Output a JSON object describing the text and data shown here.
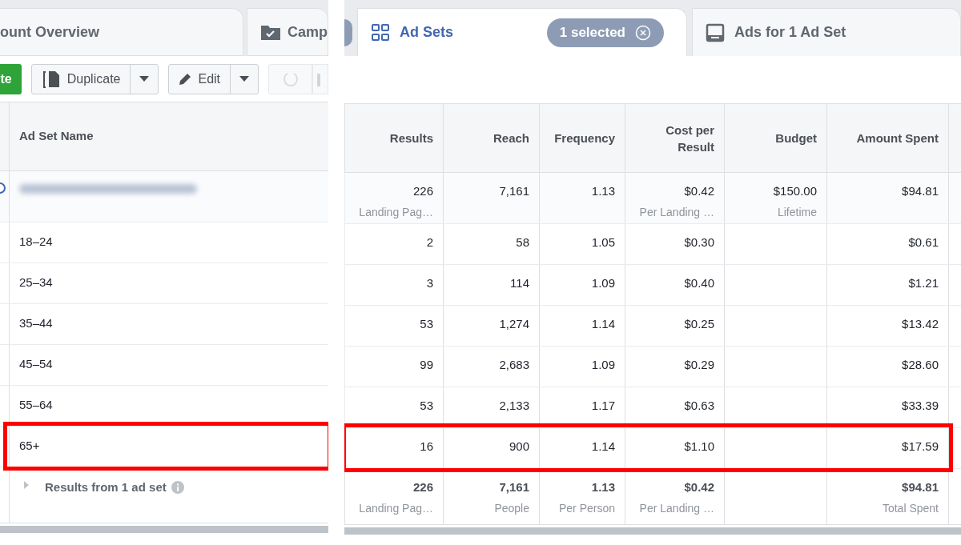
{
  "left_tabs": [
    {
      "label": "ount Overview",
      "selected": false
    },
    {
      "label": "Camp",
      "selected": false
    }
  ],
  "toolbar": [
    {
      "kind": "primary",
      "label": "te"
    },
    {
      "kind": "split",
      "label": "Duplicate"
    },
    {
      "kind": "split",
      "label": "Edit"
    },
    {
      "kind": "icon",
      "disabled": true
    },
    {
      "kind": "icon",
      "disabled": true
    }
  ],
  "right_tabs": [
    {
      "label": "Ad Sets",
      "selected": true,
      "badge": "1 selected"
    },
    {
      "label": "Ads for 1 Ad Set",
      "selected": false
    }
  ],
  "name_column": "Ad Set Name",
  "columns": [
    "Results",
    "Reach",
    "Frequency",
    "Cost per Result",
    "Budget",
    "Amount Spent"
  ],
  "rows": [
    {
      "kind": "ad_set",
      "radio_checked": true,
      "results": "226",
      "results_sub": "Landing Pag…",
      "reach": "7,161",
      "frequency": "1.13",
      "cost": "$0.42",
      "cost_sub": "Per Landing …",
      "budget": "$150.00",
      "budget_sub": "Lifetime",
      "spent": "$94.81",
      "highlighted": false
    },
    {
      "kind": "breakdown",
      "name": "18–24",
      "results": "2",
      "reach": "58",
      "frequency": "1.05",
      "cost": "$0.30",
      "spent": "$0.61",
      "highlighted": false
    },
    {
      "kind": "breakdown",
      "name": "25–34",
      "results": "3",
      "reach": "114",
      "frequency": "1.09",
      "cost": "$0.40",
      "spent": "$1.21",
      "highlighted": false
    },
    {
      "kind": "breakdown",
      "name": "35–44",
      "results": "53",
      "reach": "1,274",
      "frequency": "1.14",
      "cost": "$0.25",
      "spent": "$13.42",
      "highlighted": false
    },
    {
      "kind": "breakdown",
      "name": "45–54",
      "results": "99",
      "reach": "2,683",
      "frequency": "1.09",
      "cost": "$0.29",
      "spent": "$28.60",
      "highlighted": false
    },
    {
      "kind": "breakdown",
      "name": "55–64",
      "results": "53",
      "reach": "2,133",
      "frequency": "1.17",
      "cost": "$0.63",
      "spent": "$33.39",
      "highlighted": false
    },
    {
      "kind": "breakdown",
      "name": "65+",
      "results": "16",
      "reach": "900",
      "frequency": "1.14",
      "cost": "$1.10",
      "spent": "$17.59",
      "highlighted": true
    }
  ],
  "summary": {
    "label": "Results from **1** ad set",
    "results": "226",
    "results_sub": "Landing Pag…",
    "reach": "7,161",
    "reach_sub": "People",
    "frequency": "1.13",
    "frequency_sub": "Per Person",
    "cost": "$0.42",
    "cost_sub": "Per Landing …",
    "spent": "$94.81",
    "spent_sub": "Total Spent"
  }
}
